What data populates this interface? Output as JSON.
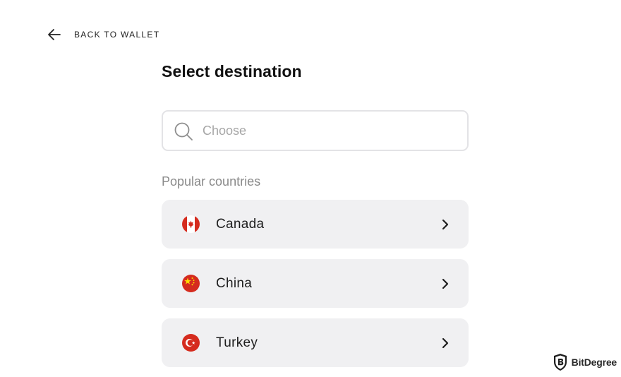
{
  "header": {
    "back_label": "BACK TO WALLET"
  },
  "page": {
    "title": "Select destination"
  },
  "search": {
    "placeholder": "Choose",
    "value": ""
  },
  "popular": {
    "label": "Popular countries",
    "countries": [
      {
        "name": "Canada",
        "flag_icon": "canada-flag-icon"
      },
      {
        "name": "China",
        "flag_icon": "china-flag-icon"
      },
      {
        "name": "Turkey",
        "flag_icon": "turkey-flag-icon"
      }
    ]
  },
  "watermark": {
    "text": "BitDegree"
  },
  "colors": {
    "row_background": "#f0f0f2",
    "flag_red": "#d52b1e",
    "flag_yellow": "#ffde00"
  }
}
